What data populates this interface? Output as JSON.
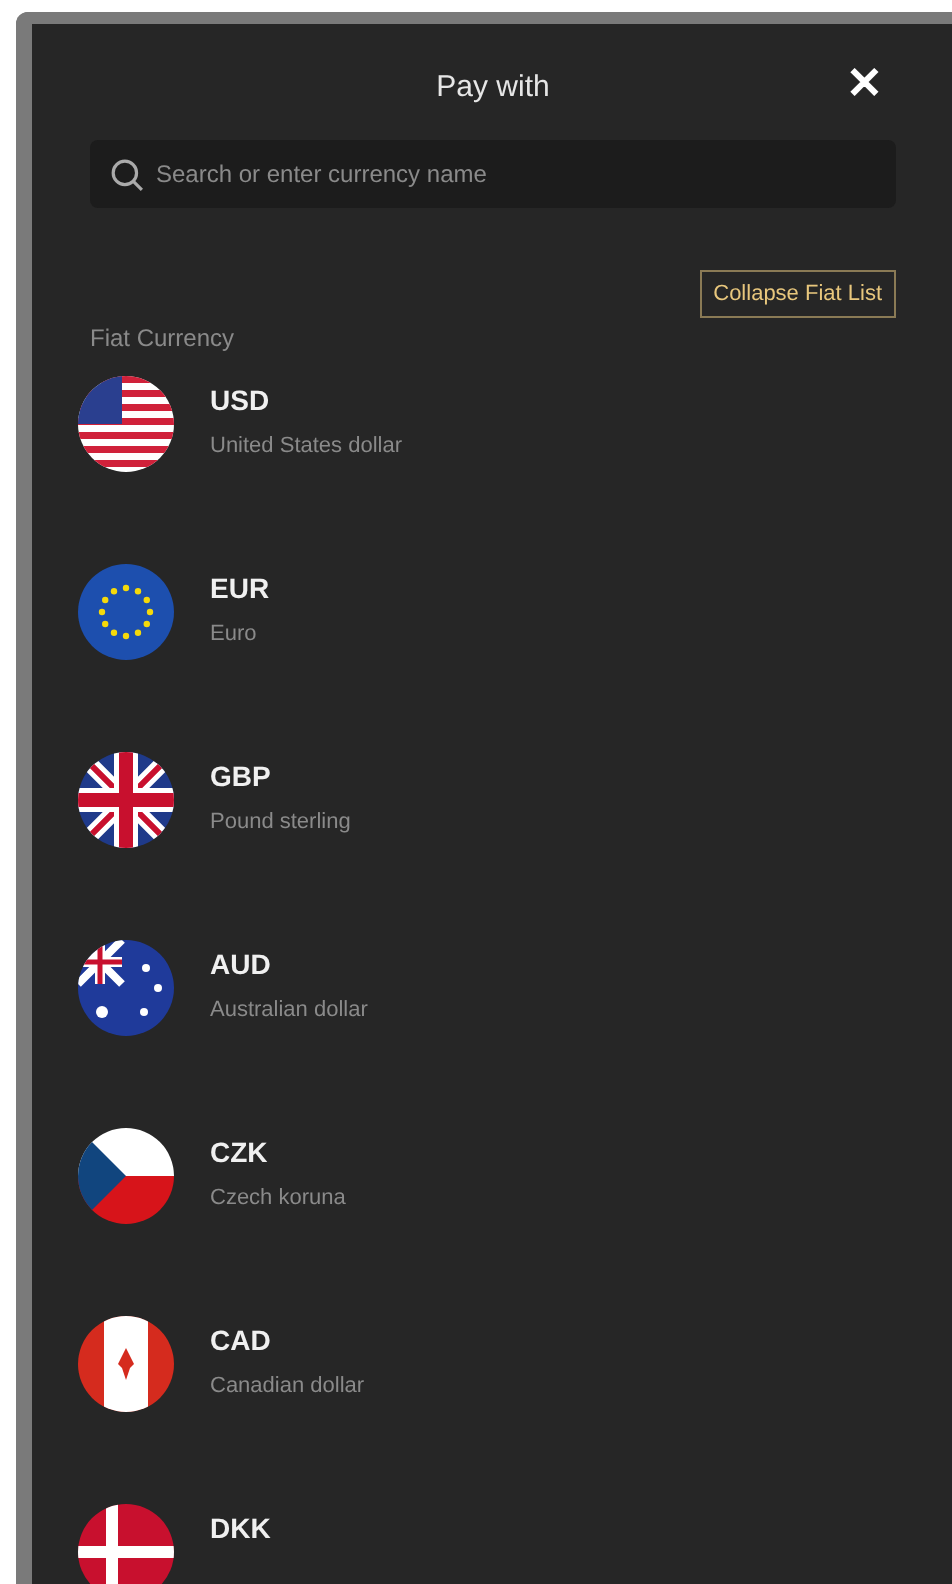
{
  "header": {
    "title": "Pay with",
    "close": "✕"
  },
  "search": {
    "placeholder": "Search or enter currency name"
  },
  "collapse_button": "Collapse Fiat List",
  "section_label": "Fiat Currency",
  "currencies": [
    {
      "code": "USD",
      "name": "United States dollar",
      "kind": "us"
    },
    {
      "code": "EUR",
      "name": "Euro",
      "kind": "eu"
    },
    {
      "code": "GBP",
      "name": "Pound sterling",
      "kind": "gb"
    },
    {
      "code": "AUD",
      "name": "Australian dollar",
      "kind": "au"
    },
    {
      "code": "CZK",
      "name": "Czech koruna",
      "kind": "cz"
    },
    {
      "code": "CAD",
      "name": "Canadian dollar",
      "kind": "ca"
    },
    {
      "code": "DKK",
      "kind": "dk"
    }
  ]
}
